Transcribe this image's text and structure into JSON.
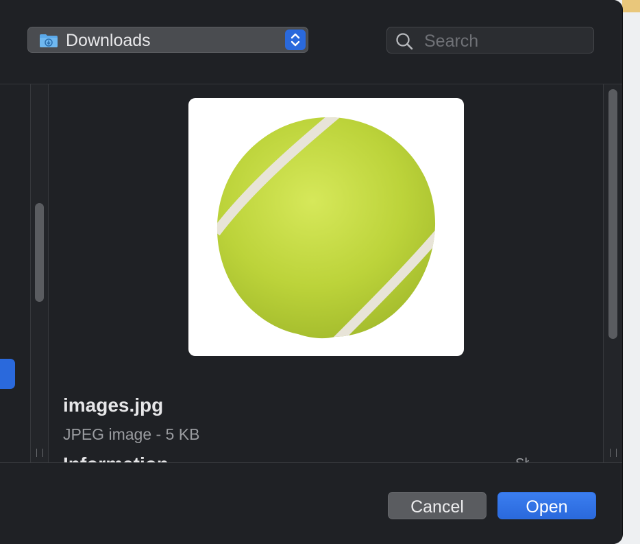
{
  "location": {
    "label": "Downloads",
    "icon": "downloads-folder-icon"
  },
  "search": {
    "placeholder": "Search"
  },
  "preview": {
    "file_name": "images.jpg",
    "file_meta": "JPEG image - 5 KB",
    "section_heading": "Information",
    "section_toggle": "Show Less",
    "thumbnail": "tennis-ball-image"
  },
  "buttons": {
    "cancel": "Cancel",
    "open": "Open"
  },
  "colors": {
    "accent": "#2a69dc",
    "dialog_bg": "#1f2125",
    "tennis_ball": "#c9dc3a"
  }
}
